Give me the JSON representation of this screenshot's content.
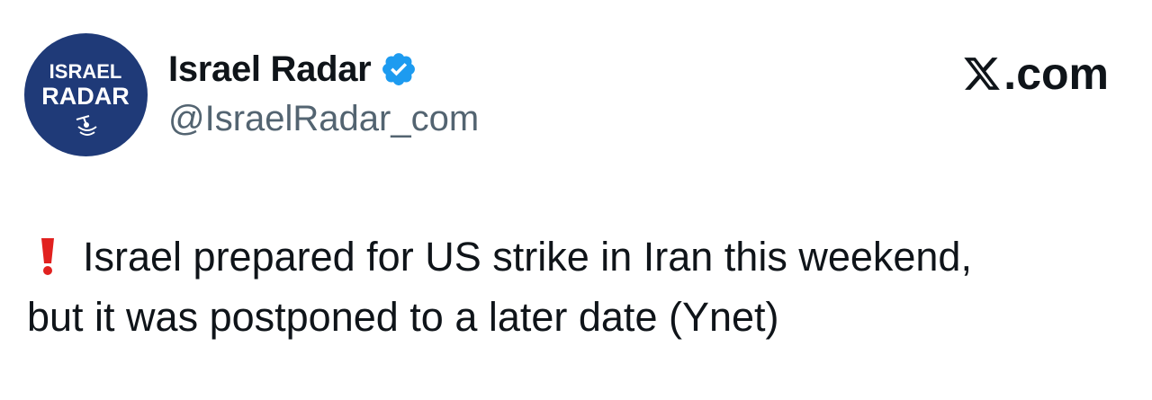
{
  "tweet": {
    "author": {
      "display_name": "Israel Radar",
      "handle": "@IsraelRadar_com",
      "avatar_text_top": "ISRAEL",
      "avatar_text_bottom": "RADAR",
      "avatar_bg_color": "#1f3a78",
      "verified": true,
      "verified_color": "#1d9bf0"
    },
    "source_label": ".com",
    "source_icon": "x-logo-icon",
    "emoji_icon": "red-exclamation-icon",
    "text_line_1": "Israel prepared for US strike in Iran this weekend,",
    "text_line_2": "but it was postponed to a later date (Ynet)"
  }
}
